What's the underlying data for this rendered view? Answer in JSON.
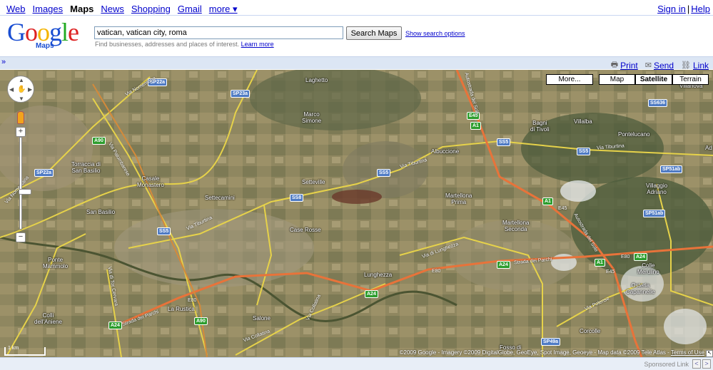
{
  "topnav": {
    "items": [
      "Web",
      "Images",
      "Maps",
      "News",
      "Shopping",
      "Gmail",
      "more ▾"
    ],
    "active": "Maps",
    "signin": "Sign in",
    "separator": "|",
    "help": "Help"
  },
  "logo": {
    "word": "Google",
    "sub": "Maps"
  },
  "search": {
    "value": "vatican, vatican city, roma",
    "button": "Search Maps",
    "options_link": "Show search options",
    "hint": "Find businesses, addresses and places of interest.",
    "learn_more": "Learn more"
  },
  "toolbar": {
    "collapse": "»",
    "print": "Print",
    "send": "Send",
    "link": "Link"
  },
  "map": {
    "types": {
      "more": "More...",
      "map": "Map",
      "satellite": "Satellite",
      "terrain": "Terrain"
    },
    "selected_type": "Satellite",
    "places": [
      "Laghetto",
      "Marco\nSimone",
      "Bagni\ndi Tivoli",
      "Villalba",
      "Pontelucano",
      "Villanova",
      "Albuccione",
      "Torraccia di\nSan Basilio",
      "Casale\nMonastero",
      "Settecamini",
      "Setteville",
      "Martellona\nPrima",
      "Villaggio\nAdriano",
      "San Basilio",
      "Case Rosse",
      "Martellona\nSeconda",
      "Ponte\nMammolo",
      "Lunghezza",
      "Colle\nMerulino",
      "Osteria\nCapannelle",
      "Colli\ndell'Aniene",
      "La Rustica",
      "Salone",
      "Corcolle",
      "Fosso di",
      "Ad"
    ],
    "road_shields": [
      "SP22a",
      "SP23a",
      "E45",
      "A1",
      "SS5",
      "SS5",
      "SS636",
      "A90",
      "SP22a",
      "SS5",
      "SP51ab",
      "SS8",
      "A1",
      "E45",
      "SP51ab",
      "SS5",
      "A24",
      "E80",
      "A24",
      "E80",
      "A1",
      "E45",
      "A24",
      "E80",
      "A90",
      "A24",
      "SP49a"
    ],
    "road_names": [
      "Via Nomentana",
      "Via Palombarese",
      "Via Tiburtina",
      "Via Tiburtina",
      "Via Tiburtina",
      "Strada dei Parchi",
      "Strada dei Parchi",
      "Via di Lunghezza",
      "Via Collatina",
      "Via Polense",
      "Autostrada del Sole",
      "Autostrada del Sole",
      "Via di Tor Cervara",
      "Via Collatina",
      "Via Nomentana"
    ],
    "scale": "1 km",
    "copyright": "©2009 Google - Imagery ©2009 DigitalGlobe, GeoEye, Spot Image, Geoeye - Map data ©2009 Tele Atlas - ",
    "terms": "Terms of Use"
  },
  "footer": {
    "sponsored": "Sponsored Link",
    "prev": "<",
    "next": ">"
  }
}
